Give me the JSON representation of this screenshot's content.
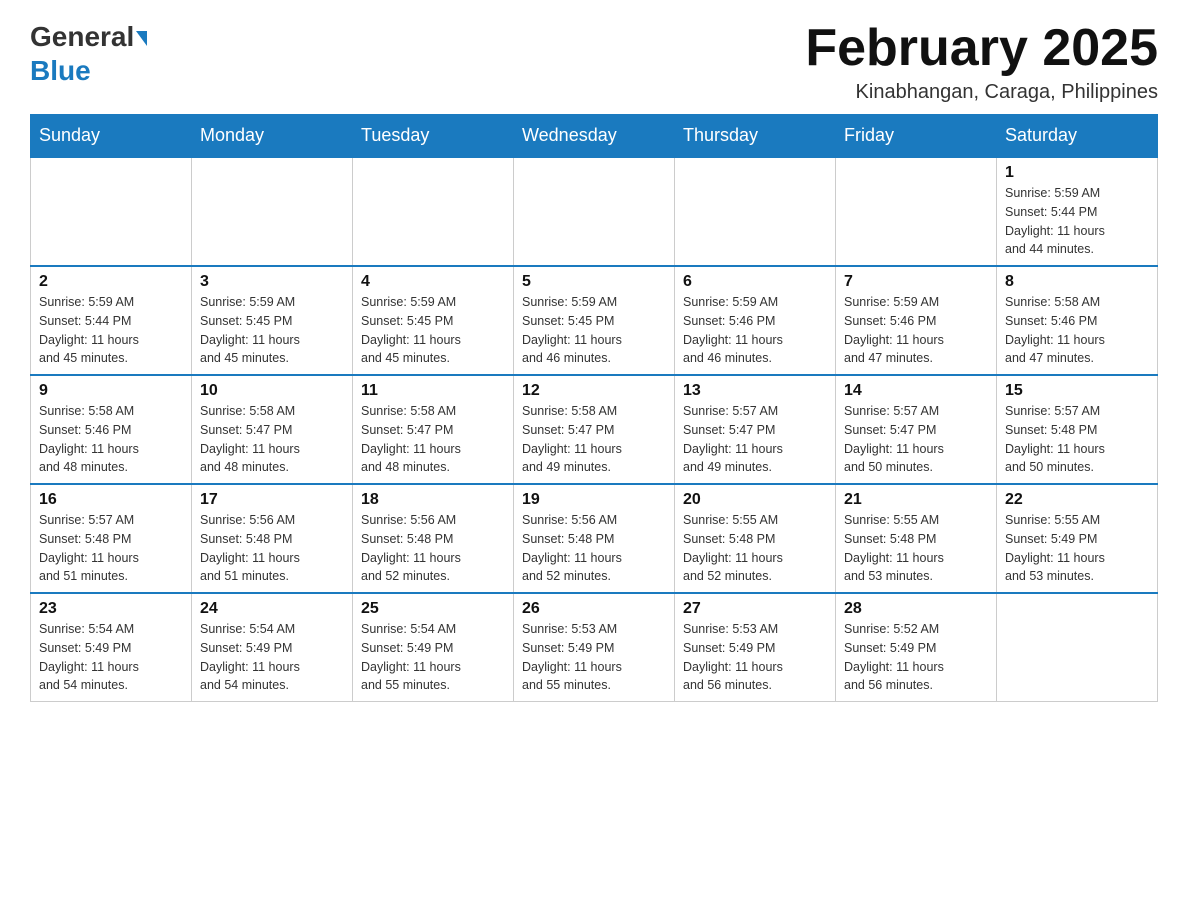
{
  "header": {
    "logo_general": "General",
    "logo_blue": "Blue",
    "month_title": "February 2025",
    "location": "Kinabhangan, Caraga, Philippines"
  },
  "weekdays": [
    "Sunday",
    "Monday",
    "Tuesday",
    "Wednesday",
    "Thursday",
    "Friday",
    "Saturday"
  ],
  "weeks": [
    {
      "days": [
        {
          "number": "",
          "info": ""
        },
        {
          "number": "",
          "info": ""
        },
        {
          "number": "",
          "info": ""
        },
        {
          "number": "",
          "info": ""
        },
        {
          "number": "",
          "info": ""
        },
        {
          "number": "",
          "info": ""
        },
        {
          "number": "1",
          "info": "Sunrise: 5:59 AM\nSunset: 5:44 PM\nDaylight: 11 hours\nand 44 minutes."
        }
      ]
    },
    {
      "days": [
        {
          "number": "2",
          "info": "Sunrise: 5:59 AM\nSunset: 5:44 PM\nDaylight: 11 hours\nand 45 minutes."
        },
        {
          "number": "3",
          "info": "Sunrise: 5:59 AM\nSunset: 5:45 PM\nDaylight: 11 hours\nand 45 minutes."
        },
        {
          "number": "4",
          "info": "Sunrise: 5:59 AM\nSunset: 5:45 PM\nDaylight: 11 hours\nand 45 minutes."
        },
        {
          "number": "5",
          "info": "Sunrise: 5:59 AM\nSunset: 5:45 PM\nDaylight: 11 hours\nand 46 minutes."
        },
        {
          "number": "6",
          "info": "Sunrise: 5:59 AM\nSunset: 5:46 PM\nDaylight: 11 hours\nand 46 minutes."
        },
        {
          "number": "7",
          "info": "Sunrise: 5:59 AM\nSunset: 5:46 PM\nDaylight: 11 hours\nand 47 minutes."
        },
        {
          "number": "8",
          "info": "Sunrise: 5:58 AM\nSunset: 5:46 PM\nDaylight: 11 hours\nand 47 minutes."
        }
      ]
    },
    {
      "days": [
        {
          "number": "9",
          "info": "Sunrise: 5:58 AM\nSunset: 5:46 PM\nDaylight: 11 hours\nand 48 minutes."
        },
        {
          "number": "10",
          "info": "Sunrise: 5:58 AM\nSunset: 5:47 PM\nDaylight: 11 hours\nand 48 minutes."
        },
        {
          "number": "11",
          "info": "Sunrise: 5:58 AM\nSunset: 5:47 PM\nDaylight: 11 hours\nand 48 minutes."
        },
        {
          "number": "12",
          "info": "Sunrise: 5:58 AM\nSunset: 5:47 PM\nDaylight: 11 hours\nand 49 minutes."
        },
        {
          "number": "13",
          "info": "Sunrise: 5:57 AM\nSunset: 5:47 PM\nDaylight: 11 hours\nand 49 minutes."
        },
        {
          "number": "14",
          "info": "Sunrise: 5:57 AM\nSunset: 5:47 PM\nDaylight: 11 hours\nand 50 minutes."
        },
        {
          "number": "15",
          "info": "Sunrise: 5:57 AM\nSunset: 5:48 PM\nDaylight: 11 hours\nand 50 minutes."
        }
      ]
    },
    {
      "days": [
        {
          "number": "16",
          "info": "Sunrise: 5:57 AM\nSunset: 5:48 PM\nDaylight: 11 hours\nand 51 minutes."
        },
        {
          "number": "17",
          "info": "Sunrise: 5:56 AM\nSunset: 5:48 PM\nDaylight: 11 hours\nand 51 minutes."
        },
        {
          "number": "18",
          "info": "Sunrise: 5:56 AM\nSunset: 5:48 PM\nDaylight: 11 hours\nand 52 minutes."
        },
        {
          "number": "19",
          "info": "Sunrise: 5:56 AM\nSunset: 5:48 PM\nDaylight: 11 hours\nand 52 minutes."
        },
        {
          "number": "20",
          "info": "Sunrise: 5:55 AM\nSunset: 5:48 PM\nDaylight: 11 hours\nand 52 minutes."
        },
        {
          "number": "21",
          "info": "Sunrise: 5:55 AM\nSunset: 5:48 PM\nDaylight: 11 hours\nand 53 minutes."
        },
        {
          "number": "22",
          "info": "Sunrise: 5:55 AM\nSunset: 5:49 PM\nDaylight: 11 hours\nand 53 minutes."
        }
      ]
    },
    {
      "days": [
        {
          "number": "23",
          "info": "Sunrise: 5:54 AM\nSunset: 5:49 PM\nDaylight: 11 hours\nand 54 minutes."
        },
        {
          "number": "24",
          "info": "Sunrise: 5:54 AM\nSunset: 5:49 PM\nDaylight: 11 hours\nand 54 minutes."
        },
        {
          "number": "25",
          "info": "Sunrise: 5:54 AM\nSunset: 5:49 PM\nDaylight: 11 hours\nand 55 minutes."
        },
        {
          "number": "26",
          "info": "Sunrise: 5:53 AM\nSunset: 5:49 PM\nDaylight: 11 hours\nand 55 minutes."
        },
        {
          "number": "27",
          "info": "Sunrise: 5:53 AM\nSunset: 5:49 PM\nDaylight: 11 hours\nand 56 minutes."
        },
        {
          "number": "28",
          "info": "Sunrise: 5:52 AM\nSunset: 5:49 PM\nDaylight: 11 hours\nand 56 minutes."
        },
        {
          "number": "",
          "info": ""
        }
      ]
    }
  ]
}
